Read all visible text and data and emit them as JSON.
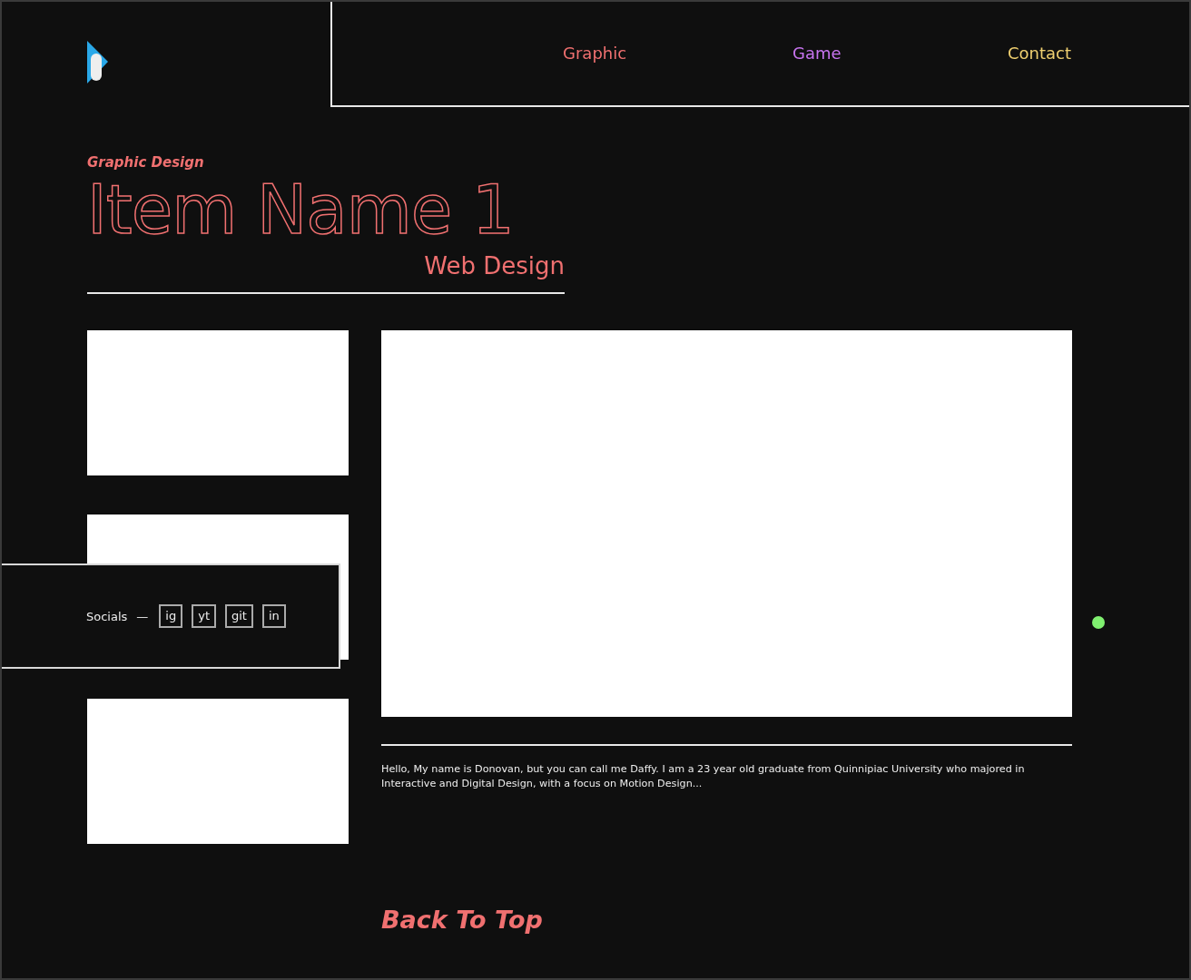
{
  "nav": [
    {
      "label": "Graphic",
      "color": "#f07070"
    },
    {
      "label": "Game",
      "color": "#c874f0"
    },
    {
      "label": "Contact",
      "color": "#f0d070"
    }
  ],
  "category": "Graphic Design",
  "title": "Item Name 1",
  "subtitle": "Web Design",
  "description": "Hello, My name is Donovan, but you can call me Daffy. I am a 23 year old graduate from Quinnipiac University who majored in Interactive and Digital Design, with a focus on Motion Design...",
  "back_to_top": "Back To Top",
  "socials": {
    "label": "Socials",
    "dash": "—",
    "links": [
      "ig",
      "yt",
      "git",
      "in"
    ]
  }
}
